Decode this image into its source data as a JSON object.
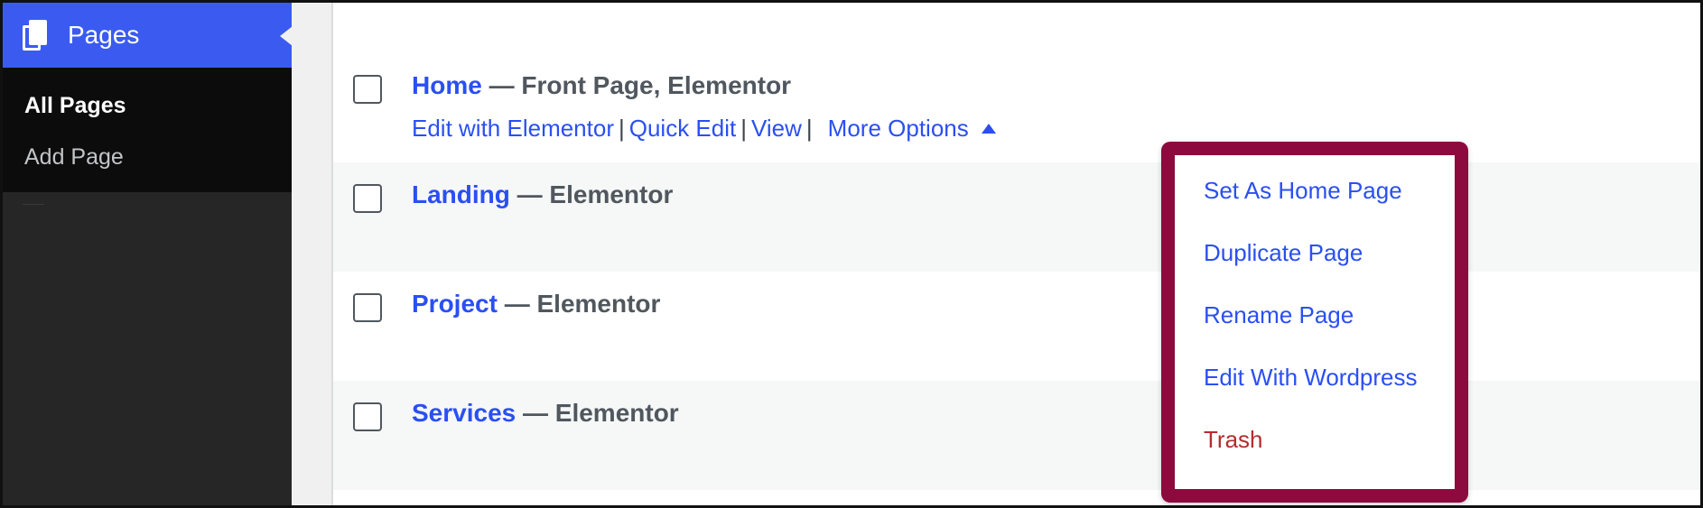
{
  "sidebar": {
    "menu_title": "Pages",
    "submenu": [
      {
        "label": "All Pages",
        "current": true
      },
      {
        "label": "Add Page",
        "current": false
      }
    ]
  },
  "pages": [
    {
      "title": "Home",
      "states": " — Front Page, Elementor"
    },
    {
      "title": "Landing",
      "states": " — Elementor"
    },
    {
      "title": "Project",
      "states": " — Elementor"
    },
    {
      "title": "Services",
      "states": " — Elementor"
    }
  ],
  "row_actions": {
    "edit_elementor": "Edit with Elementor",
    "quick_edit": "Quick Edit",
    "view": "View",
    "separator": "|",
    "more_options": "More Options"
  },
  "more_options_menu": [
    "Set As Home Page",
    "Duplicate Page",
    "Rename Page",
    "Edit With Wordpress",
    "Trash"
  ],
  "colors": {
    "sidebar_active": "#3b5bf0",
    "link": "#2a4ff2",
    "highlight_border": "#8c0a3e",
    "trash": "#b32d2e"
  }
}
